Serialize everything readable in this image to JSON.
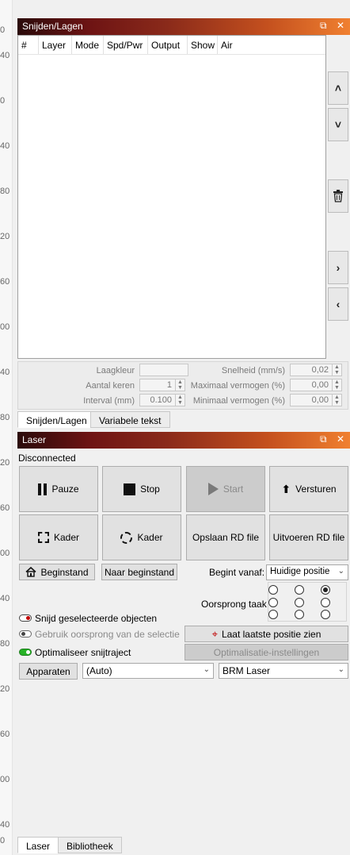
{
  "ruler": {
    "ticks": [
      "0",
      "40",
      "0",
      "40",
      "80",
      "20",
      "60",
      "00",
      "40",
      "80",
      "20",
      "60",
      "00",
      "40",
      "80",
      "20",
      "60",
      "00",
      "40",
      "0"
    ]
  },
  "layers_panel": {
    "title": "Snijden/Lagen",
    "columns": [
      "#",
      "Layer",
      "Mode",
      "Spd/Pwr",
      "Output",
      "Show",
      "Air"
    ],
    "side_buttons": [
      "up-icon",
      "down-icon",
      "trash-icon",
      "right-icon",
      "left-icon"
    ],
    "props": {
      "laagkleur_label": "Laagkleur",
      "aantal_keren_label": "Aantal keren",
      "aantal_keren_value": "1",
      "interval_label": "Interval (mm)",
      "interval_value": "0.100",
      "snelheid_label": "Snelheid (mm/s)",
      "snelheid_value": "0,02",
      "max_vermogen_label": "Maximaal vermogen (%)",
      "max_vermogen_value": "0,00",
      "min_vermogen_label": "Minimaal vermogen (%)",
      "min_vermogen_value": "0,00"
    },
    "tabs": [
      "Snijden/Lagen",
      "Variabele tekst"
    ]
  },
  "laser_panel": {
    "title": "Laser",
    "status": "Disconnected",
    "buttons": {
      "pause": "Pauze",
      "stop": "Stop",
      "start": "Start",
      "send": "Versturen",
      "frame1": "Kader",
      "frame2": "Kader",
      "save_rd": "Opslaan RD file",
      "run_rd": "Uitvoeren RD file",
      "home": "Beginstand",
      "go_origin": "Naar beginstand"
    },
    "begint_vanaf_label": "Begint vanaf:",
    "begint_vanaf_value": "Huidige positie",
    "oorsprong_label": "Oorsprong taak",
    "options": {
      "cut_selected": "Snijd geselecteerde objecten",
      "use_selection_origin": "Gebruik oorsprong van de selectie",
      "optimize": "Optimaliseer snijtraject"
    },
    "show_last_position": "Laat laatste positie zien",
    "optimization_settings": "Optimalisatie-instellingen",
    "devices_button": "Apparaten",
    "port_value": "(Auto)",
    "device_value": "BRM Laser",
    "tabs": [
      "Laser",
      "Bibliotheek"
    ]
  }
}
